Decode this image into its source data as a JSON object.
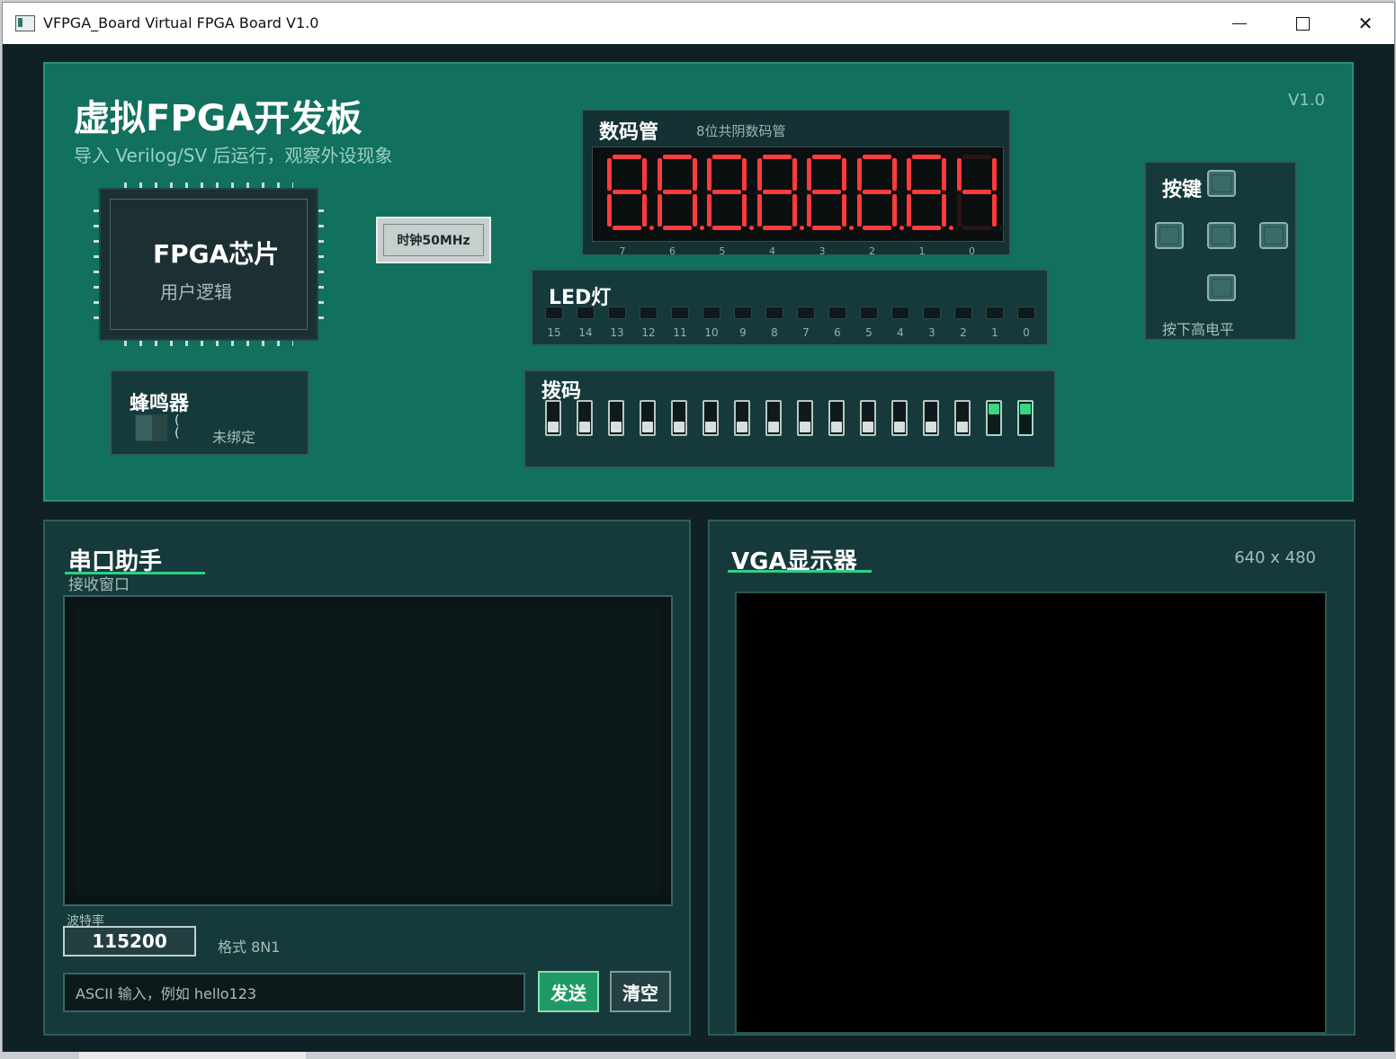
{
  "window": {
    "title": "VFPGA_Board Virtual FPGA Board V1.0"
  },
  "board": {
    "title": "虚拟FPGA开发板",
    "subtitle": "导入 Verilog/SV 后运行，观察外设现象",
    "version": "V1.0",
    "chip": {
      "title": "FPGA芯片",
      "subtitle": "用户逻辑"
    },
    "clock_button": "时钟50MHz",
    "beeper": {
      "title": "蜂鸣器",
      "status": "未绑定"
    },
    "seven_seg": {
      "title": "数码管",
      "subtitle": "8位共阴数码管",
      "digits": [
        "8",
        "8",
        "8",
        "8",
        "8",
        "8",
        "8",
        "4"
      ],
      "indices": [
        "7",
        "6",
        "5",
        "4",
        "3",
        "2",
        "1",
        "0"
      ]
    },
    "leds": {
      "title": "LED灯",
      "indices": [
        "15",
        "14",
        "13",
        "12",
        "11",
        "10",
        "9",
        "8",
        "7",
        "6",
        "5",
        "4",
        "3",
        "2",
        "1",
        "0"
      ]
    },
    "dip_switches": {
      "title": "拨码",
      "states": [
        false,
        false,
        false,
        false,
        false,
        false,
        false,
        false,
        false,
        false,
        false,
        false,
        false,
        false,
        true,
        true
      ]
    },
    "keys": {
      "title": "按键",
      "caption": "按下高电平"
    }
  },
  "uart": {
    "title": "串口助手",
    "rx_label": "接收窗口",
    "baud_label": "波特率",
    "baud_value": "115200",
    "format": "格式 8N1",
    "input_placeholder": "ASCII 输入，例如 hello123",
    "send_label": "发送",
    "clear_label": "清空"
  },
  "vga": {
    "title": "VGA显示器",
    "resolution": "640 x 480"
  },
  "colors": {
    "board": "#12705e",
    "panel": "#163a3b",
    "accent": "#2fcf86",
    "segment_on": "#ff3b3b"
  }
}
